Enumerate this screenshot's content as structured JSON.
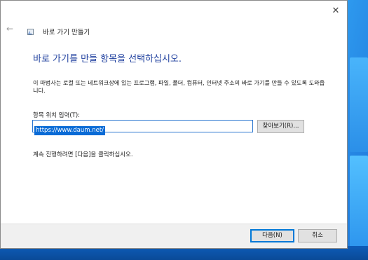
{
  "window": {
    "title": "바로 가기 만들기",
    "close_glyph": "✕",
    "back_glyph": "←"
  },
  "main": {
    "heading": "바로 가기를 만들 항목을 선택하십시오.",
    "description": "이 마법사는 로컬 또는 네트워크상에 있는 프로그램, 파일, 폴더, 컴퓨터, 인터넷 주소의 바로 가기를 만들 수 있도록 도와줍니다.",
    "location_label": "항목 위치 입력(T):",
    "location_value": "https://www.daum.net/",
    "browse_label": "찾아보기(R)...",
    "continue_text": "계속 진행하려면 [다음]을 클릭하십시오."
  },
  "footer": {
    "next_label": "다음(N)",
    "cancel_label": "취소"
  },
  "colors": {
    "heading": "#1e3f9e",
    "selection": "#0a6bd6",
    "desktop": "#1a76dc"
  }
}
